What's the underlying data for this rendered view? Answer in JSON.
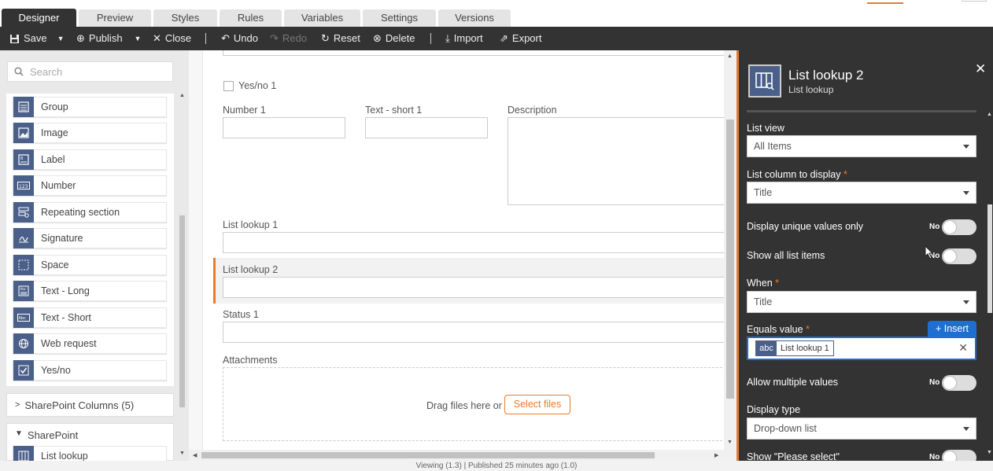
{
  "tabs": [
    {
      "label": "Designer",
      "active": true
    },
    {
      "label": "Preview"
    },
    {
      "label": "Styles"
    },
    {
      "label": "Rules"
    },
    {
      "label": "Variables"
    },
    {
      "label": "Settings"
    },
    {
      "label": "Versions"
    }
  ],
  "toolbar": {
    "save": "Save",
    "publish": "Publish",
    "close": "Close",
    "undo": "Undo",
    "redo": "Redo",
    "reset": "Reset",
    "delete": "Delete",
    "import": "Import",
    "export": "Export"
  },
  "left_panel": {
    "search_placeholder": "Search",
    "controls": [
      {
        "label": "Group",
        "icon": "group-icon"
      },
      {
        "label": "Image",
        "icon": "image-icon"
      },
      {
        "label": "Label",
        "icon": "label-icon"
      },
      {
        "label": "Number",
        "icon": "number-icon"
      },
      {
        "label": "Repeating section",
        "icon": "repeating-section-icon"
      },
      {
        "label": "Signature",
        "icon": "signature-icon"
      },
      {
        "label": "Space",
        "icon": "space-icon"
      },
      {
        "label": "Text - Long",
        "icon": "text-long-icon"
      },
      {
        "label": "Text - Short",
        "icon": "text-short-icon"
      },
      {
        "label": "Web request",
        "icon": "web-request-icon"
      },
      {
        "label": "Yes/no",
        "icon": "checkbox-icon"
      }
    ],
    "sharepoint_columns": "SharePoint Columns (5)",
    "sharepoint": "SharePoint",
    "sharepoint_items": [
      {
        "label": "List lookup",
        "icon": "list-lookup-icon"
      }
    ]
  },
  "canvas": {
    "yesno_label": "Yes/no 1",
    "number_label": "Number 1",
    "text_short_label": "Text - short 1",
    "description_label": "Description",
    "list_lookup1_label": "List lookup 1",
    "list_lookup2_label": "List lookup 2",
    "status_label": "Status 1",
    "attachments_label": "Attachments",
    "drag_text": "Drag files here or",
    "select_files": "Select files"
  },
  "right_panel": {
    "title": "List lookup 2",
    "subtitle": "List lookup",
    "list_view_label": "List view",
    "list_view_value": "All Items",
    "list_column_label": "List column to display",
    "list_column_value": "Title",
    "unique_label": "Display unique values only",
    "unique_value": "No",
    "show_all_label": "Show all list items",
    "show_all_value": "No",
    "when_label": "When",
    "when_value": "Title",
    "equals_label": "Equals value",
    "insert_label": "Insert",
    "chip_type": "abc",
    "chip_text": "List lookup 1",
    "allow_multi_label": "Allow multiple values",
    "allow_multi_value": "No",
    "display_type_label": "Display type",
    "display_type_value": "Drop-down list",
    "please_select_label": "Show \"Please select\"",
    "please_select_value": "No",
    "required_marker": "*"
  },
  "status_bar": "Viewing (1.3)  |  Published 25 minutes ago (1.0)",
  "colors": {
    "accent": "#e97b2c",
    "dark": "#333333",
    "icon_blue": "#4a5f8a",
    "insert_blue": "#1e6fd0"
  }
}
